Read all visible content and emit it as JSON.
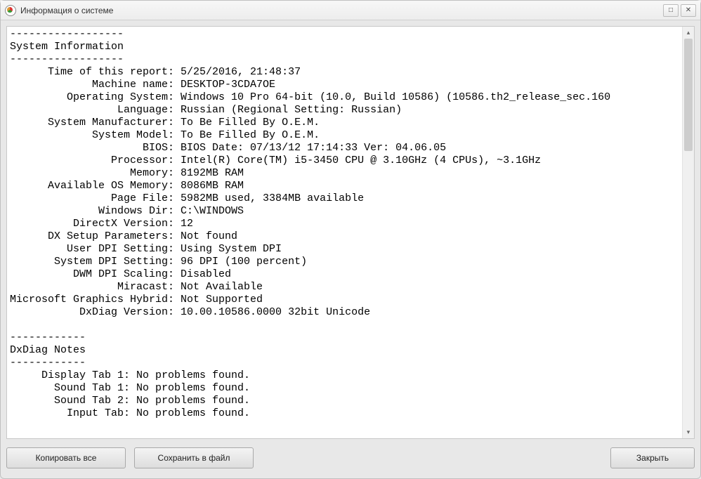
{
  "window": {
    "title": "Информация о системе",
    "maximize_glyph": "□",
    "close_glyph": "✕"
  },
  "sysinfo": {
    "divider": "------------------",
    "header": "System Information",
    "label_width": 25,
    "rows": [
      {
        "label": "Time of this report",
        "value": "5/25/2016, 21:48:37"
      },
      {
        "label": "Machine name",
        "value": "DESKTOP-3CDA7OE"
      },
      {
        "label": "Operating System",
        "value": "Windows 10 Pro 64-bit (10.0, Build 10586) (10586.th2_release_sec.160"
      },
      {
        "label": "Language",
        "value": "Russian (Regional Setting: Russian)"
      },
      {
        "label": "System Manufacturer",
        "value": "To Be Filled By O.E.M."
      },
      {
        "label": "System Model",
        "value": "To Be Filled By O.E.M."
      },
      {
        "label": "BIOS",
        "value": "BIOS Date: 07/13/12 17:14:33 Ver: 04.06.05"
      },
      {
        "label": "Processor",
        "value": "Intel(R) Core(TM) i5-3450 CPU @ 3.10GHz (4 CPUs), ~3.1GHz"
      },
      {
        "label": "Memory",
        "value": "8192MB RAM"
      },
      {
        "label": "Available OS Memory",
        "value": "8086MB RAM"
      },
      {
        "label": "Page File",
        "value": "5982MB used, 3384MB available"
      },
      {
        "label": "Windows Dir",
        "value": "C:\\WINDOWS"
      },
      {
        "label": "DirectX Version",
        "value": "12"
      },
      {
        "label": "DX Setup Parameters",
        "value": "Not found"
      },
      {
        "label": "User DPI Setting",
        "value": "Using System DPI"
      },
      {
        "label": "System DPI Setting",
        "value": "96 DPI (100 percent)"
      },
      {
        "label": "DWM DPI Scaling",
        "value": "Disabled"
      },
      {
        "label": "Miracast",
        "value": "Not Available"
      },
      {
        "label": "Microsoft Graphics Hybrid",
        "value": "Not Supported"
      },
      {
        "label": "DxDiag Version",
        "value": "10.00.10586.0000 32bit Unicode"
      }
    ]
  },
  "notes": {
    "divider": "------------",
    "header": "DxDiag Notes",
    "label_width": 18,
    "rows": [
      {
        "label": "Display Tab 1",
        "value": "No problems found."
      },
      {
        "label": "Sound Tab 1",
        "value": "No problems found."
      },
      {
        "label": "Sound Tab 2",
        "value": "No problems found."
      },
      {
        "label": "Input Tab",
        "value": "No problems found."
      }
    ]
  },
  "buttons": {
    "copy_all": "Копировать все",
    "save_to_file": "Сохранить в файл",
    "close": "Закрыть"
  }
}
